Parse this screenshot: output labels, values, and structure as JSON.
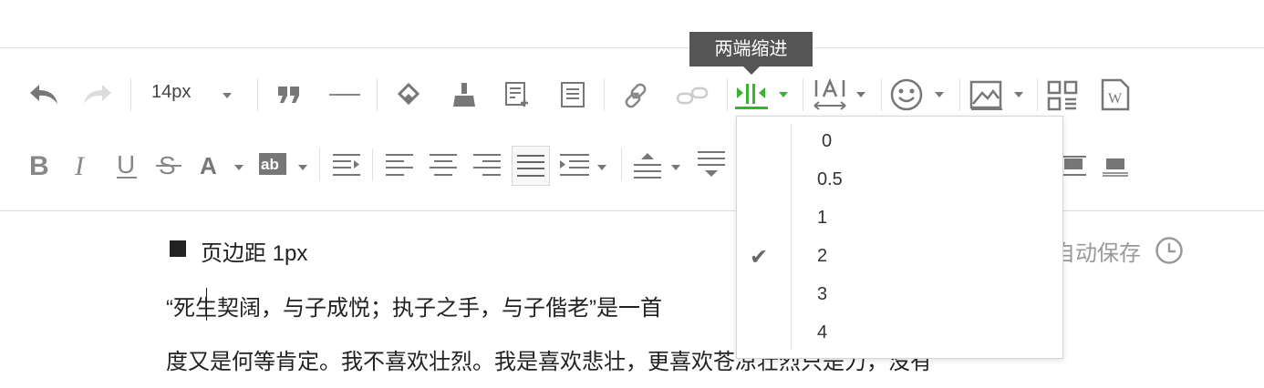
{
  "toolbar": {
    "font_size": "14px",
    "tooltip": "两端缩进",
    "tooltip_icon": "justify-indent-icon",
    "row1_icons": [
      "undo-icon",
      "redo-icon",
      "font-size-select",
      "quote-icon",
      "horizontal-rule-icon",
      "format-painter-icon",
      "clear-format-icon",
      "insert-template-icon",
      "document-icon",
      "link-icon",
      "unlink-icon",
      "justify-indent-icon",
      "letter-spacing-icon",
      "emoji-icon",
      "image-icon",
      "layout-grid-icon",
      "word-import-icon"
    ],
    "row2_icons": [
      "bold-icon",
      "italic-icon",
      "underline-icon",
      "strikethrough-icon",
      "font-color-icon",
      "highlight-icon",
      "indent-icon",
      "align-left-icon",
      "align-center-icon",
      "align-right-icon",
      "align-justify-icon",
      "line-indent-icon",
      "line-height-icon",
      "paragraph-spacing-icon",
      "paragraph-bottom-icon",
      "paragraph-top-icon"
    ],
    "active_color": "#3cb034"
  },
  "indent_menu": {
    "options": [
      "0",
      "0.5",
      "1",
      "2",
      "3",
      "4"
    ],
    "selected": "2"
  },
  "document": {
    "heading": "页边距 1px",
    "line1": "“死生契阔，与子成悦；执子之手，与子偕老”是一首",
    "line2": "度又是何等肯定。我不喜欢壮烈。我是喜欢悲壮，更喜欢苍凉壮烈只是力，没有",
    "autosave": "自动保存"
  }
}
